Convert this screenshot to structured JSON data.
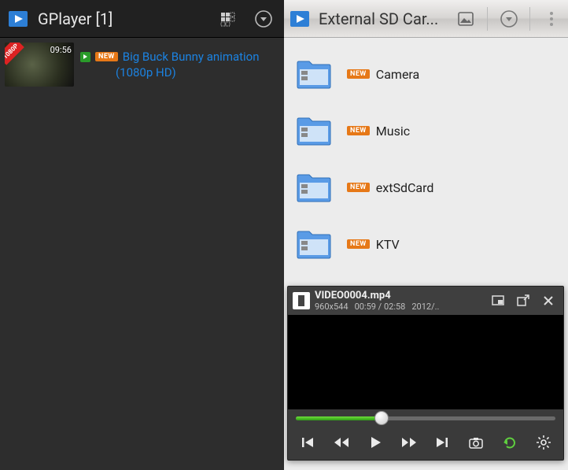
{
  "left": {
    "app_title": "GPlayer [1]",
    "videos": [
      {
        "resolution_badge": "1080P",
        "duration": "09:56",
        "new": "NEW",
        "title_line1": "Big Buck Bunny animation",
        "title_line2": "(1080p HD)"
      }
    ]
  },
  "right": {
    "app_title": "External SD Car...",
    "folders": [
      {
        "new": "NEW",
        "label": "Camera"
      },
      {
        "new": "NEW",
        "label": "Music"
      },
      {
        "new": "NEW",
        "label": "extSdCard"
      },
      {
        "new": "NEW",
        "label": "KTV"
      }
    ]
  },
  "mini_player": {
    "title": "VIDEO0004.mp4",
    "resolution": "960x544",
    "time": "00:59 / 02:58",
    "date": "2012/..",
    "progress_pct": 33
  }
}
